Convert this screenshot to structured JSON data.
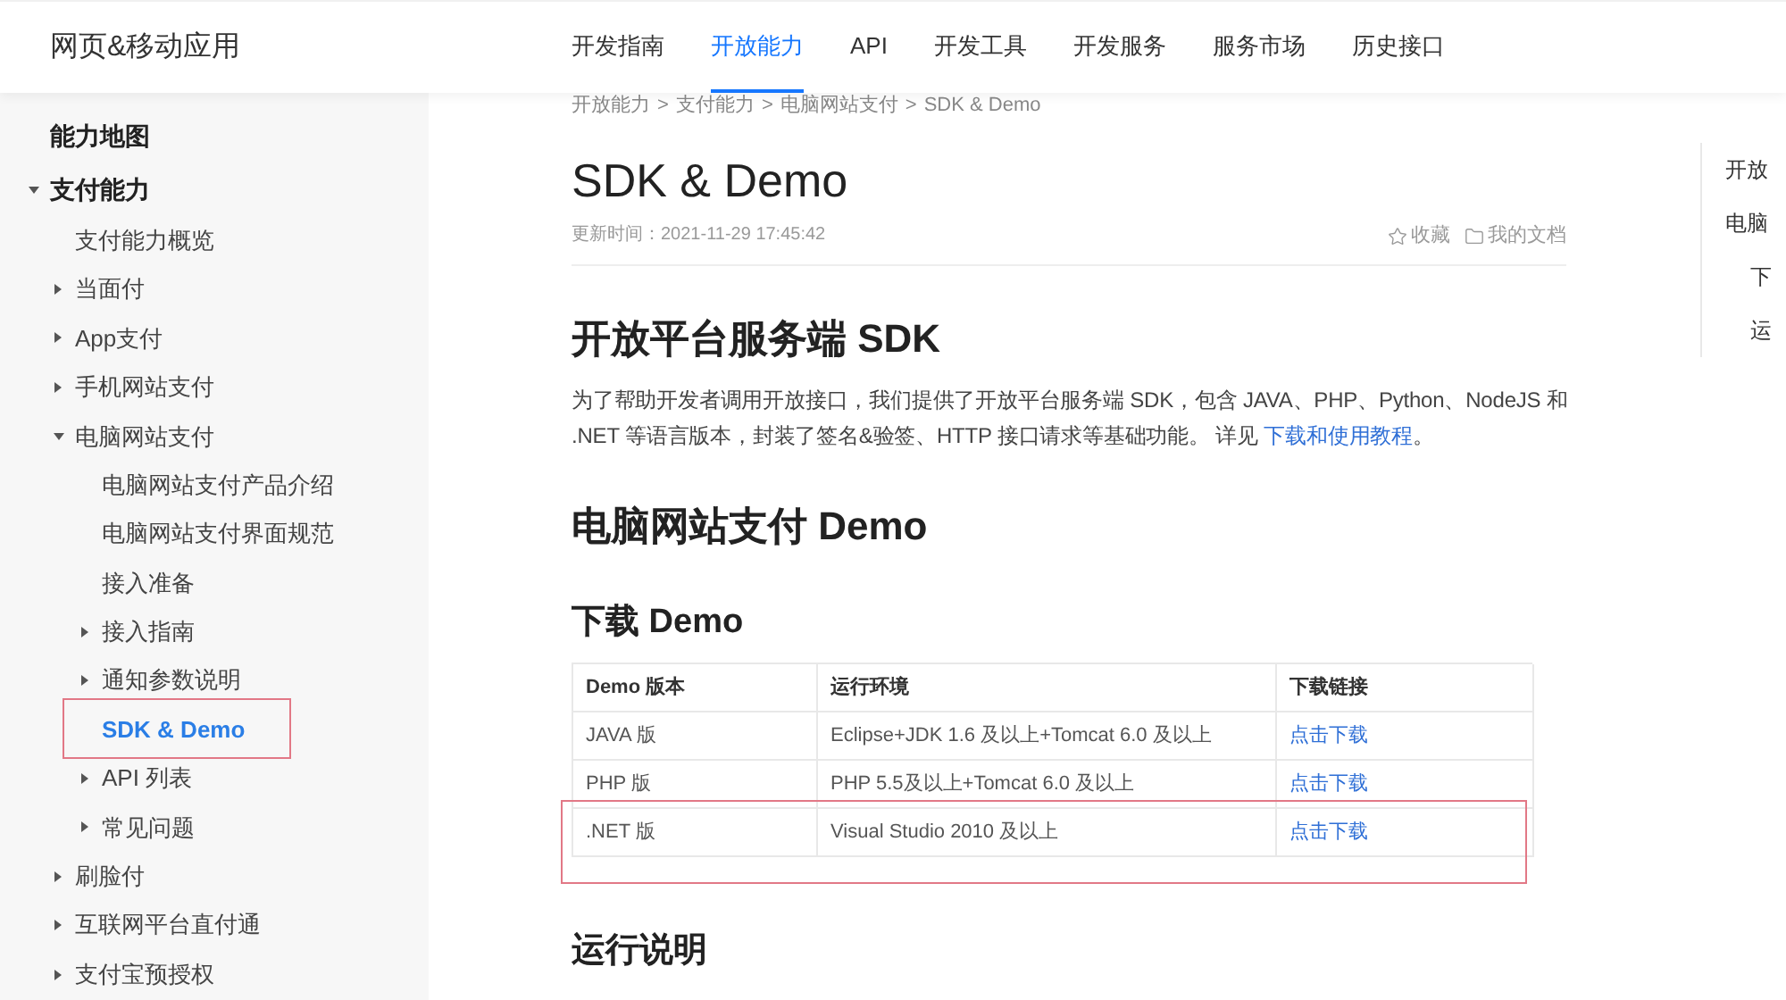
{
  "header": {
    "title": "网页&移动应用",
    "nav": [
      {
        "label": "开发指南",
        "selected": false
      },
      {
        "label": "开放能力",
        "selected": true
      },
      {
        "label": "API",
        "selected": false
      },
      {
        "label": "开发工具",
        "selected": false
      },
      {
        "label": "开发服务",
        "selected": false
      },
      {
        "label": "服务市场",
        "selected": false
      },
      {
        "label": "历史接口",
        "selected": false
      }
    ]
  },
  "sidebar": {
    "items": [
      {
        "label": "能力地图",
        "kind": "page",
        "selected": false,
        "annotated": false
      },
      {
        "label": "支付能力",
        "kind": "folder",
        "expanded": true,
        "selected": false,
        "annotated": false,
        "children": [
          {
            "label": "支付能力概览",
            "kind": "page",
            "selected": false,
            "annotated": false
          },
          {
            "label": "当面付",
            "kind": "folder",
            "expanded": false,
            "selected": false,
            "annotated": false
          },
          {
            "label": "App支付",
            "kind": "folder",
            "expanded": false,
            "selected": false,
            "annotated": false
          },
          {
            "label": "手机网站支付",
            "kind": "folder",
            "expanded": false,
            "selected": false,
            "annotated": false
          },
          {
            "label": "电脑网站支付",
            "kind": "folder",
            "expanded": true,
            "selected": false,
            "annotated": false,
            "children": [
              {
                "label": "电脑网站支付产品介绍",
                "kind": "page",
                "selected": false,
                "annotated": false
              },
              {
                "label": "电脑网站支付界面规范",
                "kind": "page",
                "selected": false,
                "annotated": false
              },
              {
                "label": "接入准备",
                "kind": "page",
                "selected": false,
                "annotated": false
              },
              {
                "label": "接入指南",
                "kind": "folder",
                "expanded": false,
                "selected": false,
                "annotated": false
              },
              {
                "label": "通知参数说明",
                "kind": "folder",
                "expanded": false,
                "selected": false,
                "annotated": false
              },
              {
                "label": "SDK & Demo",
                "kind": "page",
                "selected": true,
                "annotated": true
              },
              {
                "label": "API 列表",
                "kind": "folder",
                "expanded": false,
                "selected": false,
                "annotated": false
              },
              {
                "label": "常见问题",
                "kind": "folder",
                "expanded": false,
                "selected": false,
                "annotated": false
              }
            ]
          },
          {
            "label": "刷脸付",
            "kind": "folder",
            "expanded": false,
            "selected": false,
            "annotated": false
          },
          {
            "label": "互联网平台直付通",
            "kind": "folder",
            "expanded": false,
            "selected": false,
            "annotated": false
          },
          {
            "label": "支付宝预授权",
            "kind": "folder",
            "expanded": false,
            "selected": false,
            "annotated": false
          }
        ]
      }
    ]
  },
  "breadcrumb": {
    "separator": ">",
    "items": [
      "开放能力",
      "支付能力",
      "电脑网站支付",
      "SDK & Demo"
    ]
  },
  "page": {
    "title": "SDK & Demo",
    "updated": "更新时间：2021-11-29 17:45:42",
    "actions": [
      {
        "label": "收藏",
        "kind": "favorite"
      },
      {
        "label": "我的文档",
        "kind": "documents"
      }
    ]
  },
  "sdk_section": {
    "heading": "开放平台服务端 SDK",
    "paragraph": {
      "text": "为了帮助开发者调用开放接口，我们提供了开放平台服务端 SDK，包含 JAVA、PHP、Python、NodeJS 和 .NET 等语言版本，封装了签名&验签、HTTP 接口请求等基础功能。 详见 ",
      "link": "下载和使用教程",
      "text_after": "。"
    }
  },
  "demo_section": {
    "heading": "电脑网站支付 Demo"
  },
  "download": {
    "heading": "下载 Demo",
    "table": {
      "columns": [
        "Demo 版本",
        "运行环境",
        "下载链接"
      ],
      "rows": [
        {
          "version": "JAVA 版",
          "environment": "Eclipse+JDK 1.6 及以上+Tomcat 6.0 及以上",
          "download": "点击下载",
          "annotated": false
        },
        {
          "version": "PHP 版",
          "environment": "PHP 5.5及以上+Tomcat 6.0 及以上",
          "download": "点击下载",
          "annotated": false
        },
        {
          "version": ".NET 版",
          "environment": "Visual Studio 2010 及以上",
          "download": "点击下载",
          "annotated": true
        }
      ]
    }
  },
  "run_section": {
    "heading": "运行说明"
  },
  "toc": {
    "items": [
      {
        "label": "开放"
      },
      {
        "label": "电脑",
        "children": [
          {
            "label": "下"
          },
          {
            "label": "运"
          }
        ]
      }
    ]
  }
}
